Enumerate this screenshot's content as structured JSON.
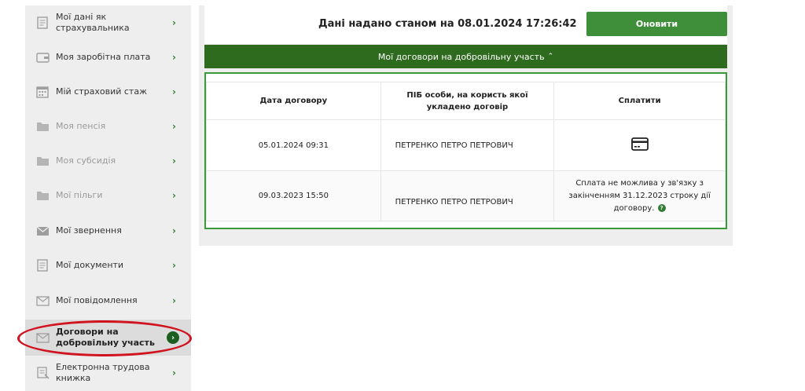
{
  "sidebar": {
    "items": [
      {
        "label": "Мої дані як страхувальника",
        "icon": "document-icon",
        "state": "normal"
      },
      {
        "label": "Моя заробітна плата",
        "icon": "wallet-icon",
        "state": "normal"
      },
      {
        "label": "Мій страховий стаж",
        "icon": "calendar-icon",
        "state": "normal"
      },
      {
        "label": "Моя пенсія",
        "icon": "folder-icon",
        "state": "disabled"
      },
      {
        "label": "Моя субсидія",
        "icon": "folder-icon",
        "state": "disabled"
      },
      {
        "label": "Мої пільги",
        "icon": "folder-icon",
        "state": "disabled"
      },
      {
        "label": "Мої звернення",
        "icon": "envelope-icon",
        "state": "normal"
      },
      {
        "label": "Мої документи",
        "icon": "document-icon",
        "state": "normal"
      },
      {
        "label": "Мої повідомлення",
        "icon": "envelope-outline-icon",
        "state": "normal"
      },
      {
        "label": "Договори на добровільну участь",
        "icon": "envelope-outline-icon",
        "state": "active"
      },
      {
        "label": "Електронна трудова книжка",
        "icon": "book-icon",
        "state": "normal"
      }
    ]
  },
  "header": {
    "title": "Дані надано станом на 08.01.2024 17:26:42",
    "refresh_label": "Оновити"
  },
  "section": {
    "title": "Мої договори на добровільну участь",
    "caret": "⌃"
  },
  "table": {
    "headers": {
      "date": "Дата договору",
      "person": "ПІБ особи, на користь якої укладено договір",
      "pay": "Сплатити"
    },
    "rows": [
      {
        "date": "05.01.2024 09:31",
        "person": "ПЕТРЕНКО ПЕТРО ПЕТРОВИЧ",
        "pay_icon": "credit-card-icon"
      },
      {
        "date": "09.03.2023 15:50",
        "person": "ПЕТРЕНКО ПЕТРО ПЕТРОВИЧ",
        "pay_note": "Сплата не можлива у зв'язку з закінченням 31.12.2023 строку дії договору.",
        "help_icon": "?"
      }
    ]
  },
  "colors": {
    "accent_green": "#3f8f3a",
    "dark_green": "#2e6b1f",
    "highlight_red": "#d0131f"
  }
}
